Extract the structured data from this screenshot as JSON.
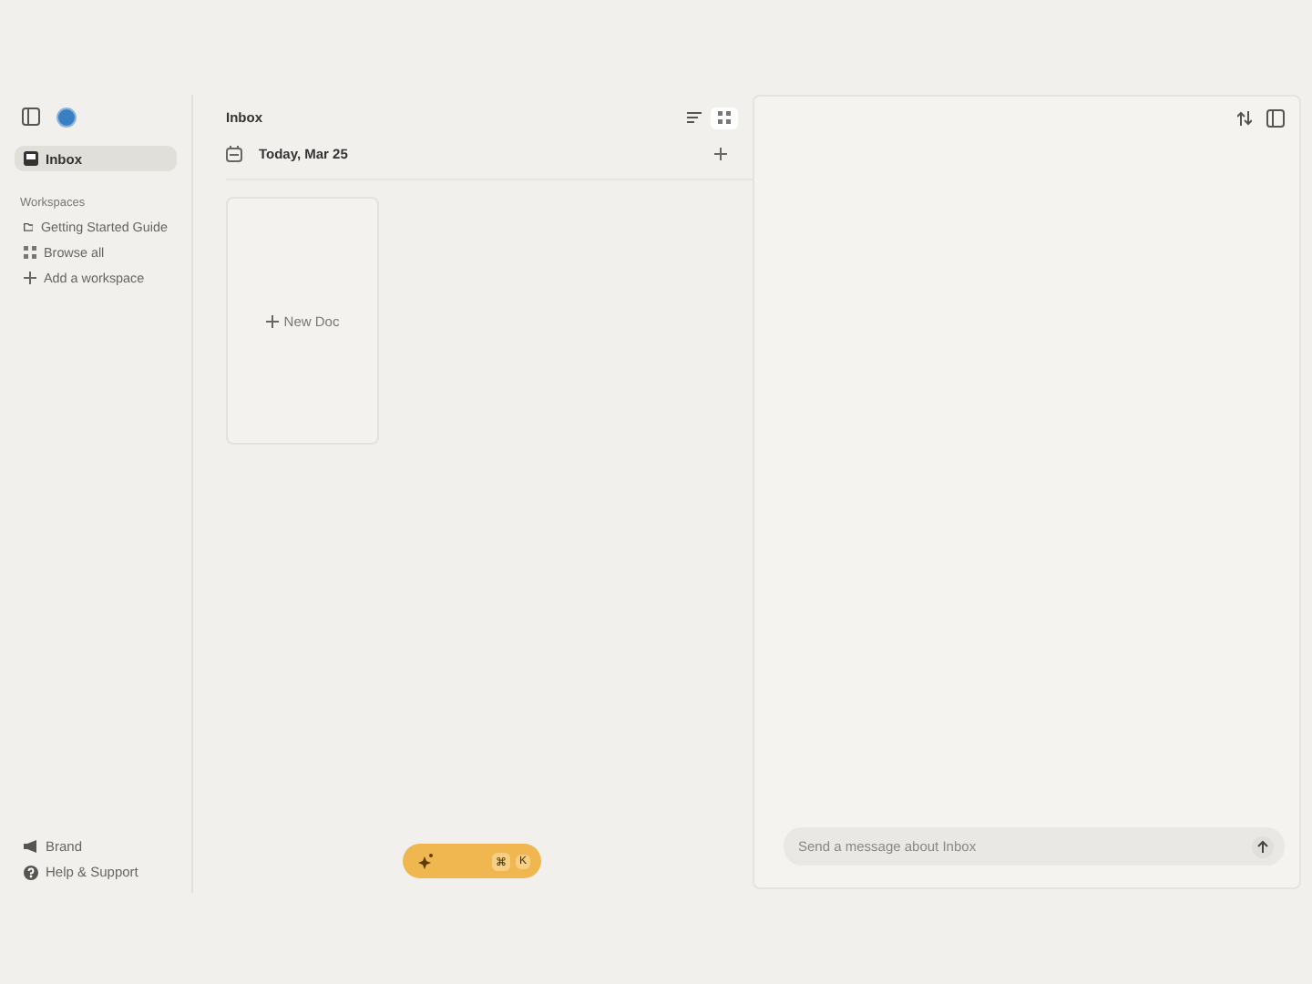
{
  "sidebar": {
    "nav": [
      {
        "label": "Inbox",
        "selected": true
      }
    ],
    "section_title": "Workspaces",
    "workspaces": [
      {
        "label": "Getting Started Guide",
        "kind": "folder"
      },
      {
        "label": "Browse all",
        "kind": "grid"
      },
      {
        "label": "Add a workspace",
        "kind": "add"
      }
    ],
    "footer": [
      {
        "label": "Brand",
        "kind": "megaphone"
      },
      {
        "label": "Help & Support",
        "kind": "help"
      }
    ]
  },
  "main": {
    "title": "Inbox",
    "views": [
      {
        "kind": "list",
        "selected": false
      },
      {
        "kind": "grid",
        "selected": true
      }
    ],
    "date": "Today, Mar 25",
    "new_doc": "New Doc",
    "command_bar": {
      "keys": [
        "⌘",
        "K"
      ]
    }
  },
  "chat": {
    "placeholder": "Send a message about Inbox"
  }
}
